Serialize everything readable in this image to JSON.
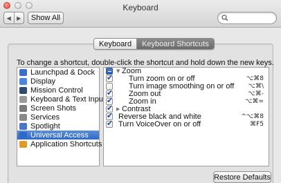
{
  "window": {
    "title": "Keyboard"
  },
  "toolbar": {
    "back_glyph": "◀",
    "forward_glyph": "▶",
    "show_all_label": "Show All",
    "search_placeholder": "",
    "search_value": ""
  },
  "tabs": [
    {
      "label": "Keyboard",
      "active": false
    },
    {
      "label": "Keyboard Shortcuts",
      "active": true
    }
  ],
  "instructions": "To change a shortcut, double-click the shortcut and hold down the new keys.",
  "categories": [
    {
      "label": "Launchpad & Dock",
      "icon": "launchpad-icon",
      "color": "#3b6fc9"
    },
    {
      "label": "Display",
      "icon": "display-icon",
      "color": "#4a86e0"
    },
    {
      "label": "Mission Control",
      "icon": "mission-control-icon",
      "color": "#2e4a6e"
    },
    {
      "label": "Keyboard & Text Input",
      "icon": "keyboard-icon",
      "color": "#9a9a9a"
    },
    {
      "label": "Screen Shots",
      "icon": "screenshot-icon",
      "color": "#7a7a7a"
    },
    {
      "label": "Services",
      "icon": "services-icon",
      "color": "#8a8a8a"
    },
    {
      "label": "Spotlight",
      "icon": "spotlight-icon",
      "color": "#4a76c8"
    },
    {
      "label": "Universal Access",
      "icon": "universal-access-icon",
      "color": "#2f6ac8",
      "selected": true
    },
    {
      "label": "Application Shortcuts",
      "icon": "app-shortcuts-icon",
      "color": "#e09a2a"
    }
  ],
  "shortcuts": [
    {
      "label": "Zoom",
      "group": true,
      "expanded": true,
      "state": "mixed",
      "key": ""
    },
    {
      "label": "Turn zoom on or off",
      "state": "checked",
      "key": "⌥⌘8"
    },
    {
      "label": "Turn image smoothing on or off",
      "state": "unchecked",
      "key": "⌥⌘\\"
    },
    {
      "label": "Zoom out",
      "state": "checked",
      "key": "⌥⌘-"
    },
    {
      "label": "Zoom in",
      "state": "checked",
      "key": "⌥⌘="
    },
    {
      "label": "Contrast",
      "group": true,
      "expanded": false,
      "state": "checked",
      "key": ""
    },
    {
      "label": "Reverse black and white",
      "state": "checked",
      "key": "^⌥⌘8"
    },
    {
      "label": "Turn VoiceOver on or off",
      "state": "checked",
      "key": "⌘F5"
    }
  ],
  "footer": {
    "restore_label": "Restore Defaults"
  },
  "colors": {
    "selection": "#3b6fc9",
    "check": "#1c47a8"
  }
}
